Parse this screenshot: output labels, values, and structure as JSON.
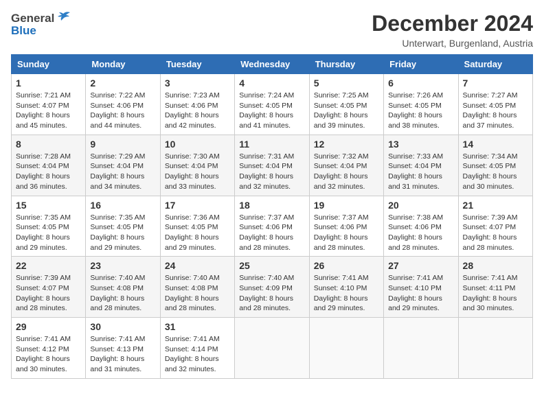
{
  "header": {
    "logo_general": "General",
    "logo_blue": "Blue",
    "month_year": "December 2024",
    "location": "Unterwart, Burgenland, Austria"
  },
  "days_of_week": [
    "Sunday",
    "Monday",
    "Tuesday",
    "Wednesday",
    "Thursday",
    "Friday",
    "Saturday"
  ],
  "weeks": [
    [
      {
        "day": "1",
        "info": "Sunrise: 7:21 AM\nSunset: 4:07 PM\nDaylight: 8 hours\nand 45 minutes."
      },
      {
        "day": "2",
        "info": "Sunrise: 7:22 AM\nSunset: 4:06 PM\nDaylight: 8 hours\nand 44 minutes."
      },
      {
        "day": "3",
        "info": "Sunrise: 7:23 AM\nSunset: 4:06 PM\nDaylight: 8 hours\nand 42 minutes."
      },
      {
        "day": "4",
        "info": "Sunrise: 7:24 AM\nSunset: 4:05 PM\nDaylight: 8 hours\nand 41 minutes."
      },
      {
        "day": "5",
        "info": "Sunrise: 7:25 AM\nSunset: 4:05 PM\nDaylight: 8 hours\nand 39 minutes."
      },
      {
        "day": "6",
        "info": "Sunrise: 7:26 AM\nSunset: 4:05 PM\nDaylight: 8 hours\nand 38 minutes."
      },
      {
        "day": "7",
        "info": "Sunrise: 7:27 AM\nSunset: 4:05 PM\nDaylight: 8 hours\nand 37 minutes."
      }
    ],
    [
      {
        "day": "8",
        "info": "Sunrise: 7:28 AM\nSunset: 4:04 PM\nDaylight: 8 hours\nand 36 minutes."
      },
      {
        "day": "9",
        "info": "Sunrise: 7:29 AM\nSunset: 4:04 PM\nDaylight: 8 hours\nand 34 minutes."
      },
      {
        "day": "10",
        "info": "Sunrise: 7:30 AM\nSunset: 4:04 PM\nDaylight: 8 hours\nand 33 minutes."
      },
      {
        "day": "11",
        "info": "Sunrise: 7:31 AM\nSunset: 4:04 PM\nDaylight: 8 hours\nand 32 minutes."
      },
      {
        "day": "12",
        "info": "Sunrise: 7:32 AM\nSunset: 4:04 PM\nDaylight: 8 hours\nand 32 minutes."
      },
      {
        "day": "13",
        "info": "Sunrise: 7:33 AM\nSunset: 4:04 PM\nDaylight: 8 hours\nand 31 minutes."
      },
      {
        "day": "14",
        "info": "Sunrise: 7:34 AM\nSunset: 4:05 PM\nDaylight: 8 hours\nand 30 minutes."
      }
    ],
    [
      {
        "day": "15",
        "info": "Sunrise: 7:35 AM\nSunset: 4:05 PM\nDaylight: 8 hours\nand 29 minutes."
      },
      {
        "day": "16",
        "info": "Sunrise: 7:35 AM\nSunset: 4:05 PM\nDaylight: 8 hours\nand 29 minutes."
      },
      {
        "day": "17",
        "info": "Sunrise: 7:36 AM\nSunset: 4:05 PM\nDaylight: 8 hours\nand 29 minutes."
      },
      {
        "day": "18",
        "info": "Sunrise: 7:37 AM\nSunset: 4:06 PM\nDaylight: 8 hours\nand 28 minutes."
      },
      {
        "day": "19",
        "info": "Sunrise: 7:37 AM\nSunset: 4:06 PM\nDaylight: 8 hours\nand 28 minutes."
      },
      {
        "day": "20",
        "info": "Sunrise: 7:38 AM\nSunset: 4:06 PM\nDaylight: 8 hours\nand 28 minutes."
      },
      {
        "day": "21",
        "info": "Sunrise: 7:39 AM\nSunset: 4:07 PM\nDaylight: 8 hours\nand 28 minutes."
      }
    ],
    [
      {
        "day": "22",
        "info": "Sunrise: 7:39 AM\nSunset: 4:07 PM\nDaylight: 8 hours\nand 28 minutes."
      },
      {
        "day": "23",
        "info": "Sunrise: 7:40 AM\nSunset: 4:08 PM\nDaylight: 8 hours\nand 28 minutes."
      },
      {
        "day": "24",
        "info": "Sunrise: 7:40 AM\nSunset: 4:08 PM\nDaylight: 8 hours\nand 28 minutes."
      },
      {
        "day": "25",
        "info": "Sunrise: 7:40 AM\nSunset: 4:09 PM\nDaylight: 8 hours\nand 28 minutes."
      },
      {
        "day": "26",
        "info": "Sunrise: 7:41 AM\nSunset: 4:10 PM\nDaylight: 8 hours\nand 29 minutes."
      },
      {
        "day": "27",
        "info": "Sunrise: 7:41 AM\nSunset: 4:10 PM\nDaylight: 8 hours\nand 29 minutes."
      },
      {
        "day": "28",
        "info": "Sunrise: 7:41 AM\nSunset: 4:11 PM\nDaylight: 8 hours\nand 30 minutes."
      }
    ],
    [
      {
        "day": "29",
        "info": "Sunrise: 7:41 AM\nSunset: 4:12 PM\nDaylight: 8 hours\nand 30 minutes."
      },
      {
        "day": "30",
        "info": "Sunrise: 7:41 AM\nSunset: 4:13 PM\nDaylight: 8 hours\nand 31 minutes."
      },
      {
        "day": "31",
        "info": "Sunrise: 7:41 AM\nSunset: 4:14 PM\nDaylight: 8 hours\nand 32 minutes."
      },
      {
        "day": "",
        "info": ""
      },
      {
        "day": "",
        "info": ""
      },
      {
        "day": "",
        "info": ""
      },
      {
        "day": "",
        "info": ""
      }
    ]
  ]
}
